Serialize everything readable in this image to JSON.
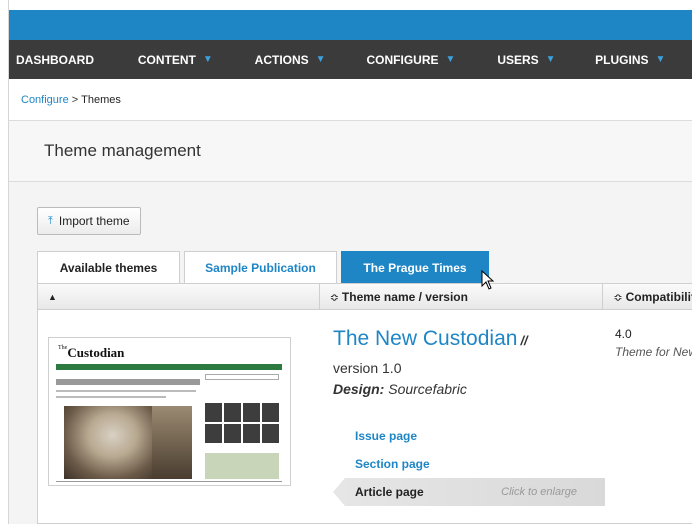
{
  "nav": {
    "items": [
      {
        "label": "DASHBOARD",
        "has_caret": false
      },
      {
        "label": "CONTENT",
        "has_caret": true
      },
      {
        "label": "ACTIONS",
        "has_caret": true
      },
      {
        "label": "CONFIGURE",
        "has_caret": true
      },
      {
        "label": "USERS",
        "has_caret": true
      },
      {
        "label": "PLUGINS",
        "has_caret": true
      }
    ],
    "caret": "▼"
  },
  "breadcrumb": {
    "parent": "Configure",
    "separator": ">",
    "current": "Themes"
  },
  "page_title": "Theme management",
  "import_button": {
    "icon": "upload-icon",
    "label": "Import theme"
  },
  "tabs": [
    {
      "label": "Available themes",
      "state": "default"
    },
    {
      "label": "Sample Publication",
      "state": "link"
    },
    {
      "label": "The Prague Times",
      "state": "selected"
    }
  ],
  "table": {
    "col_sort_indicator": "▲",
    "sort_symbol": "≎",
    "col_name": "Theme name / version",
    "col_compat": "Compatibility"
  },
  "theme": {
    "name": "The New Custodian",
    "separator": "//",
    "version": "version 1.0",
    "design_label": "Design:",
    "design_value": "Sourcefabric",
    "thumbnail_masthead_prefix": "The",
    "thumbnail_masthead": "Custodian",
    "compat_version": "4.0",
    "compat_desc": "Theme for Newscoop",
    "pages": [
      {
        "label": "Issue page",
        "active": false
      },
      {
        "label": "Section page",
        "active": false
      },
      {
        "label": "Article page",
        "active": true,
        "hint": "Click to enlarge"
      }
    ]
  },
  "colors": {
    "accent": "#1f86c6",
    "nav_bg": "#3b3b3b",
    "caret": "#3ba2e0"
  }
}
